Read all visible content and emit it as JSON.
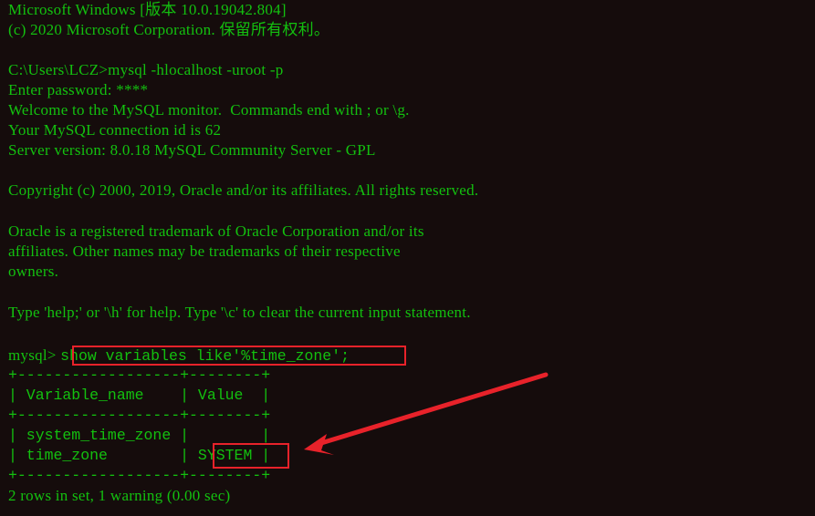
{
  "terminal": {
    "header_line_1": "Microsoft Windows [版本 10.0.19042.804]",
    "header_line_2": "(c) 2020 Microsoft Corporation. 保留所有权利。",
    "prompt_path": "C:\\Users\\LCZ>",
    "login_command": "mysql -hlocalhost -uroot -p",
    "password_line": "Enter password: ****",
    "welcome_line": "Welcome to the MySQL monitor.  Commands end with ; or \\g.",
    "connection_line": "Your MySQL connection id is 62",
    "server_version_line": "Server version: 8.0.18 MySQL Community Server - GPL",
    "copyright_line": "Copyright (c) 2000, 2019, Oracle and/or its affiliates. All rights reserved.",
    "trademark_line_1": "Oracle is a registered trademark of Oracle Corporation and/or its",
    "trademark_line_2": "affiliates. Other names may be trademarks of their respective",
    "trademark_line_3": "owners.",
    "help_line": "Type 'help;' or '\\h' for help. Type '\\c' to clear the current input statement.",
    "mysql_prompt": "mysql>",
    "query": "show variables like'%time_zone';",
    "result": {
      "border": "+------------------+--------+",
      "columns": [
        "Variable_name",
        "Value"
      ],
      "header_row": "| Variable_name    | Value  |",
      "rows": [
        {
          "name": "system_time_zone",
          "value": "",
          "text": "| system_time_zone |        |"
        },
        {
          "name": "time_zone",
          "value": "SYSTEM",
          "text": "| time_zone        | SYSTEM |"
        }
      ],
      "summary": "2 rows in set, 1 warning (0.00 sec)"
    }
  },
  "annotations": {
    "highlight_color": "#e8222a",
    "arrow_icon": "red-arrow-pointing-left"
  }
}
